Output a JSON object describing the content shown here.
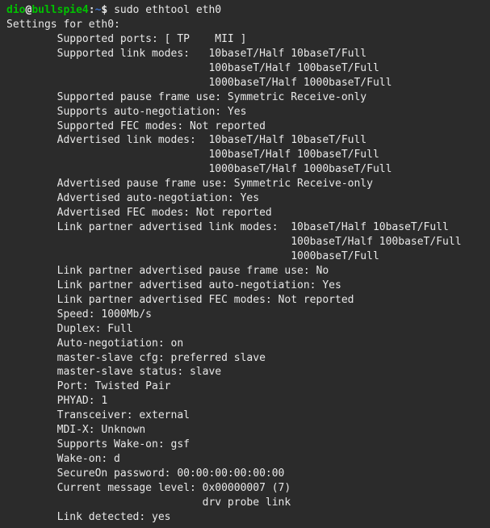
{
  "prompt": {
    "user": "dio",
    "host": "bullspie4",
    "path": "~",
    "symbol": "$"
  },
  "command": "sudo ethtool eth0",
  "output": {
    "l0": "Settings for eth0:",
    "l1": "        Supported ports: [ TP    MII ]",
    "l2": "        Supported link modes:   10baseT/Half 10baseT/Full",
    "l3": "                                100baseT/Half 100baseT/Full",
    "l4": "                                1000baseT/Half 1000baseT/Full",
    "l5": "        Supported pause frame use: Symmetric Receive-only",
    "l6": "        Supports auto-negotiation: Yes",
    "l7": "        Supported FEC modes: Not reported",
    "l8": "        Advertised link modes:  10baseT/Half 10baseT/Full",
    "l9": "                                100baseT/Half 100baseT/Full",
    "l10": "                                1000baseT/Half 1000baseT/Full",
    "l11": "        Advertised pause frame use: Symmetric Receive-only",
    "l12": "        Advertised auto-negotiation: Yes",
    "l13": "        Advertised FEC modes: Not reported",
    "l14": "        Link partner advertised link modes:  10baseT/Half 10baseT/Full",
    "l15": "                                             100baseT/Half 100baseT/Full",
    "l16": "                                             1000baseT/Full",
    "l17": "        Link partner advertised pause frame use: No",
    "l18": "        Link partner advertised auto-negotiation: Yes",
    "l19": "        Link partner advertised FEC modes: Not reported",
    "l20": "        Speed: 1000Mb/s",
    "l21": "        Duplex: Full",
    "l22": "        Auto-negotiation: on",
    "l23": "        master-slave cfg: preferred slave",
    "l24": "        master-slave status: slave",
    "l25": "        Port: Twisted Pair",
    "l26": "        PHYAD: 1",
    "l27": "        Transceiver: external",
    "l28": "        MDI-X: Unknown",
    "l29": "        Supports Wake-on: gsf",
    "l30": "        Wake-on: d",
    "l31": "        SecureOn password: 00:00:00:00:00:00",
    "l32": "        Current message level: 0x00000007 (7)",
    "l33": "                               drv probe link",
    "l34": "        Link detected: yes"
  }
}
